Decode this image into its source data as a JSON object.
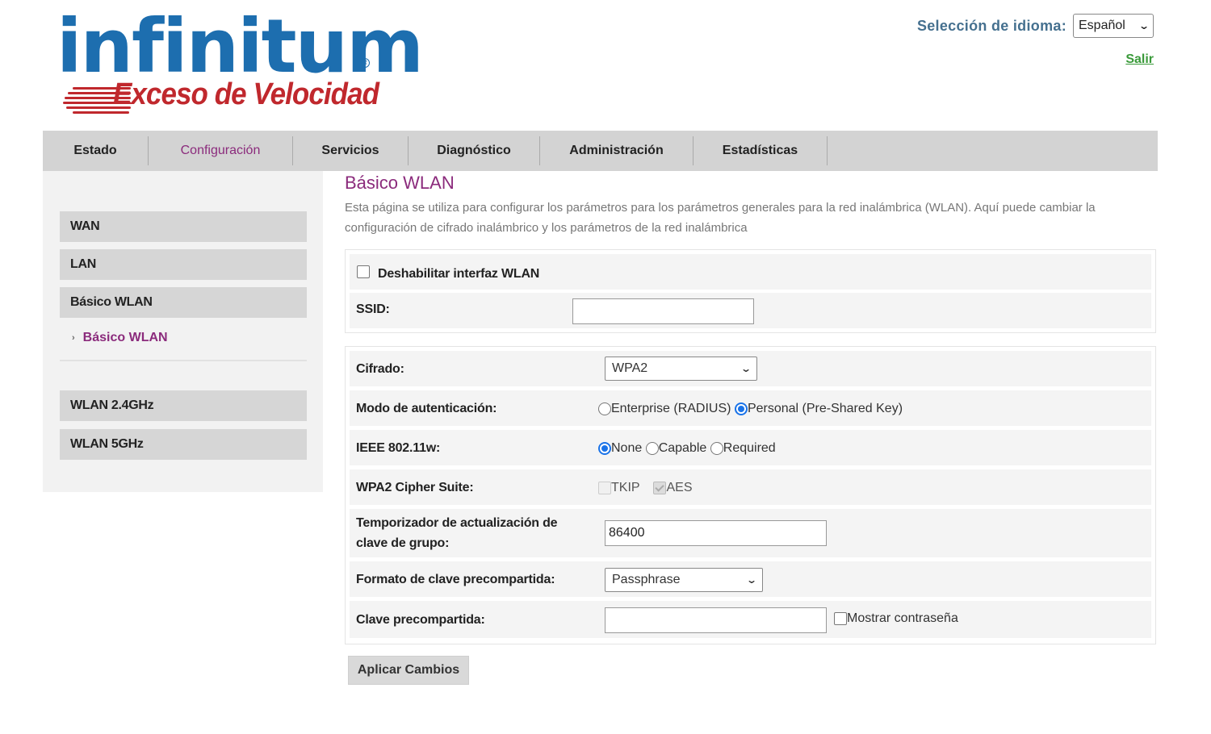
{
  "brand": {
    "name": "infinitum",
    "registered_mark": "R",
    "tagline": "Exceso de Velocidad",
    "primary_color": "#1d6eaf",
    "secondary_color": "#c0282d"
  },
  "header": {
    "language_label": "Selección de idioma:",
    "language_value": "Español",
    "logout_label": "Salir"
  },
  "topnav": {
    "tabs": [
      {
        "label": "Estado"
      },
      {
        "label": "Configuración",
        "active": true
      },
      {
        "label": "Servicios"
      },
      {
        "label": "Diagnóstico"
      },
      {
        "label": "Administración"
      },
      {
        "label": "Estadísticas"
      }
    ]
  },
  "sidebar": {
    "items": [
      {
        "label": "WAN"
      },
      {
        "label": "LAN"
      },
      {
        "label": "Básico WLAN"
      },
      {
        "label": "WLAN 2.4GHz"
      },
      {
        "label": "WLAN 5GHz"
      }
    ],
    "subitem": "Básico WLAN"
  },
  "main": {
    "title": "Básico WLAN",
    "description": "Esta página se utiliza para configurar los parámetros para los parámetros generales para la red inalámbrica (WLAN). Aquí puede cambiar la configuración de cifrado inalámbrico y los parámetros de la red inalámbrica",
    "disable_wlan": {
      "label": "Deshabilitar interfaz WLAN",
      "checked": false
    },
    "ssid": {
      "label": "SSID:",
      "value": ""
    },
    "cipher": {
      "label": "Cifrado:",
      "value": "WPA2"
    },
    "auth_mode": {
      "label": "Modo de autenticación:",
      "options": [
        "Enterprise (RADIUS)",
        "Personal (Pre-Shared Key)"
      ],
      "selected": "Personal (Pre-Shared Key)"
    },
    "ieee": {
      "label": "IEEE 802.11w:",
      "options": [
        "None",
        "Capable",
        "Required"
      ],
      "selected": "None"
    },
    "cipher_suite": {
      "label": "WPA2 Cipher Suite:",
      "options": [
        "TKIP",
        "AES"
      ],
      "checked": [
        "AES"
      ]
    },
    "group_key": {
      "label": "Temporizador de actualización de clave de grupo:",
      "value": "86400"
    },
    "psk_format": {
      "label": "Formato de clave precompartida:",
      "value": "Passphrase"
    },
    "psk": {
      "label": "Clave precompartida:",
      "value": "",
      "show_password_label": "Mostrar contraseña"
    },
    "apply_label": "Aplicar Cambios"
  }
}
